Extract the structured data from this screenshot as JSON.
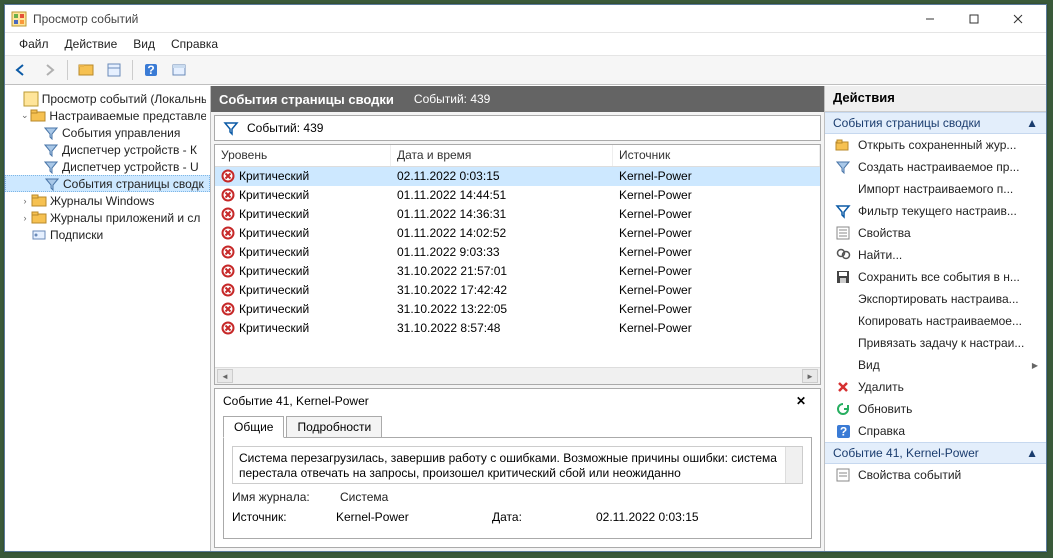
{
  "window": {
    "title": "Просмотр событий"
  },
  "menus": [
    "Файл",
    "Действие",
    "Вид",
    "Справка"
  ],
  "tree": {
    "root": "Просмотр событий (Локальны",
    "custom_views": "Настраиваемые представлен",
    "items": [
      "События управления",
      "Диспетчер устройств - К",
      "Диспетчер устройств - U",
      "События страницы сводк"
    ],
    "win_logs": "Журналы Windows",
    "app_logs": "Журналы приложений и сл",
    "subs": "Подписки"
  },
  "center": {
    "title": "События страницы сводки",
    "count_label": "Событий: 439",
    "filter_text": "Событий: 439",
    "columns": {
      "level": "Уровень",
      "date": "Дата и время",
      "source": "Источник"
    },
    "rows": [
      {
        "level": "Критический",
        "date": "02.11.2022 0:03:15",
        "source": "Kernel-Power"
      },
      {
        "level": "Критический",
        "date": "01.11.2022 14:44:51",
        "source": "Kernel-Power"
      },
      {
        "level": "Критический",
        "date": "01.11.2022 14:36:31",
        "source": "Kernel-Power"
      },
      {
        "level": "Критический",
        "date": "01.11.2022 14:02:52",
        "source": "Kernel-Power"
      },
      {
        "level": "Критический",
        "date": "01.11.2022 9:03:33",
        "source": "Kernel-Power"
      },
      {
        "level": "Критический",
        "date": "31.10.2022 21:57:01",
        "source": "Kernel-Power"
      },
      {
        "level": "Критический",
        "date": "31.10.2022 17:42:42",
        "source": "Kernel-Power"
      },
      {
        "level": "Критический",
        "date": "31.10.2022 13:22:05",
        "source": "Kernel-Power"
      },
      {
        "level": "Критический",
        "date": "31.10.2022 8:57:48",
        "source": "Kernel-Power"
      }
    ]
  },
  "detail": {
    "title": "Событие 41, Kernel-Power",
    "tabs": {
      "general": "Общие",
      "details": "Подробности"
    },
    "message": "Система перезагрузилась, завершив работу с ошибками. Возможные причины ошибки: система перестала отвечать на запросы, произошел критический сбой или неожиданно",
    "log_label": "Имя журнала:",
    "log_value": "Система",
    "src_label": "Источник:",
    "src_value": "Kernel-Power",
    "date_label": "Дата:",
    "date_value": "02.11.2022 0:03:15"
  },
  "actions": {
    "header": "Действия",
    "g1_title": "События страницы сводки",
    "g1": [
      "Открыть сохраненный жур...",
      "Создать настраиваемое пр...",
      "Импорт настраиваемого п...",
      "Фильтр текущего настраив...",
      "Свойства",
      "Найти...",
      "Сохранить все события в н...",
      "Экспортировать настраива...",
      "Копировать настраиваемое...",
      "Привязать задачу к настраи...",
      "Вид",
      "Удалить",
      "Обновить",
      "Справка"
    ],
    "g2_title": "Событие 41, Kernel-Power",
    "g2": [
      "Свойства событий"
    ]
  }
}
